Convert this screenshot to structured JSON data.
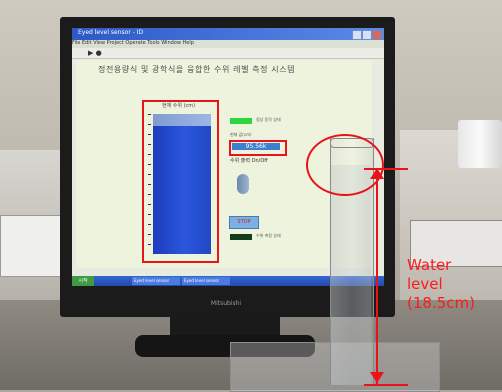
{
  "window": {
    "title": "Eyed level sensor - ID"
  },
  "menu": {
    "text": "File  Edit  View  Project  Operate  Tools  Window  Help"
  },
  "page": {
    "title": "정전용량식 및 광학식을 융합한 수위 레벨 측정 시스템"
  },
  "tank": {
    "label": "현재 수위 (cm)"
  },
  "value": {
    "label": "현재 값(cm)",
    "reading": "95.56k"
  },
  "status": {
    "indicator_1": "정상 동작 상태",
    "indicator_2": "수위 측정 상태"
  },
  "switch": {
    "label": "수위 출력 On/Off"
  },
  "stop_button": {
    "label": "STOP"
  },
  "taskbar": {
    "start": "시작",
    "item1": "Eyed level sensor",
    "item2": "Eyed level sensor"
  },
  "monitor": {
    "brand": "Mitsubishi"
  },
  "annotation": {
    "line1": "Water",
    "line2": "level",
    "line3": "(18.5cm)"
  },
  "colors": {
    "annotation": "#e8141a",
    "water_fill": "#2148c4",
    "indicator_on": "#2bd63f"
  }
}
